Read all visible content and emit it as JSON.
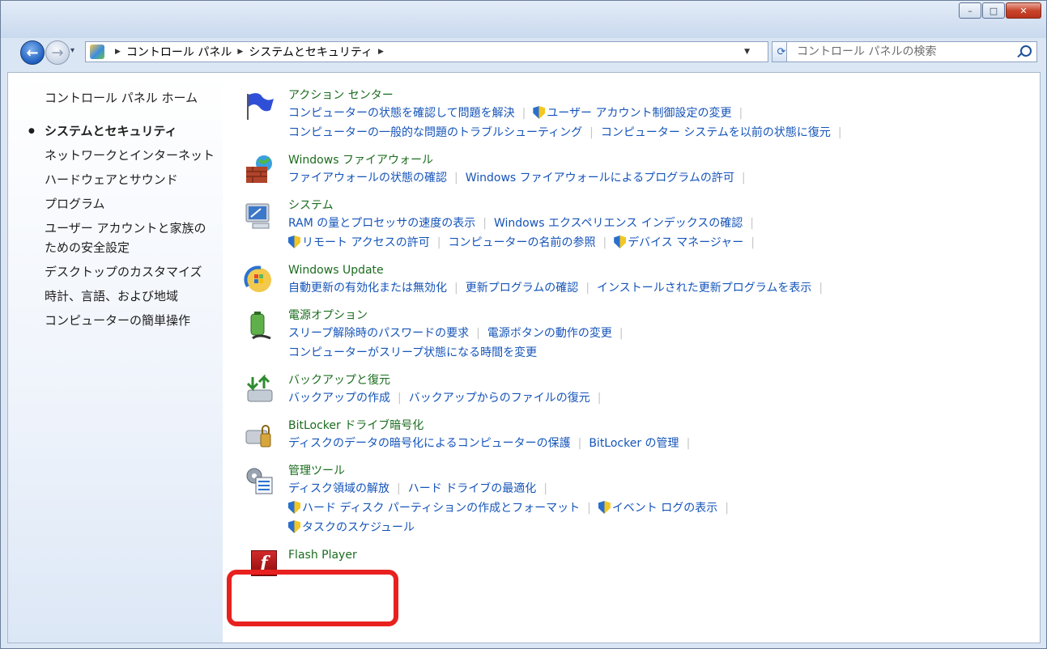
{
  "window": {
    "minimize_glyph": "–",
    "maximize_glyph": "□",
    "close_glyph": "✕"
  },
  "nav": {
    "back_glyph": "←",
    "forward_glyph": "→",
    "dropdown_glyph": "▾",
    "breadcrumb": [
      "コントロール パネル",
      "システムとセキュリティ"
    ],
    "crumb_sep": "▶",
    "address_dropdown_glyph": "▼",
    "refresh_glyph": "⟳",
    "search_placeholder": "コントロール パネルの検索"
  },
  "sidebar": {
    "home": "コントロール パネル ホーム",
    "items": [
      {
        "label": "システムとセキュリティ",
        "active": true
      },
      {
        "label": "ネットワークとインターネット"
      },
      {
        "label": "ハードウェアとサウンド"
      },
      {
        "label": "プログラム"
      },
      {
        "label": "ユーザー アカウントと家族のための安全設定"
      },
      {
        "label": "デスクトップのカスタマイズ"
      },
      {
        "label": "時計、言語、および地域"
      },
      {
        "label": "コンピューターの簡単操作"
      }
    ]
  },
  "categories": [
    {
      "title": "アクション センター",
      "icon": "flag-icon",
      "links": [
        [
          {
            "text": "コンピューターの状態を確認して問題を解決"
          },
          {
            "text": "ユーザー アカウント制御設定の変更",
            "shield": true
          }
        ],
        [
          {
            "text": "コンピューターの一般的な問題のトラブルシューティング"
          },
          {
            "text": "コンピューター システムを以前の状態に復元"
          }
        ]
      ]
    },
    {
      "title": "Windows ファイアウォール",
      "icon": "firewall-icon",
      "links": [
        [
          {
            "text": "ファイアウォールの状態の確認"
          },
          {
            "text": "Windows ファイアウォールによるプログラムの許可"
          }
        ]
      ]
    },
    {
      "title": "システム",
      "icon": "system-icon",
      "links": [
        [
          {
            "text": "RAM の量とプロセッサの速度の表示"
          },
          {
            "text": "Windows エクスペリエンス インデックスの確認"
          }
        ],
        [
          {
            "text": "リモート アクセスの許可",
            "shield": true
          },
          {
            "text": "コンピューターの名前の参照"
          },
          {
            "text": "デバイス マネージャー",
            "shield": true
          }
        ]
      ]
    },
    {
      "title": "Windows Update",
      "icon": "windows-update-icon",
      "links": [
        [
          {
            "text": "自動更新の有効化または無効化"
          },
          {
            "text": "更新プログラムの確認"
          },
          {
            "text": "インストールされた更新プログラムを表示"
          }
        ]
      ]
    },
    {
      "title": "電源オプション",
      "icon": "battery-icon",
      "links": [
        [
          {
            "text": "スリープ解除時のパスワードの要求"
          },
          {
            "text": "電源ボタンの動作の変更"
          }
        ],
        [
          {
            "text": "コンピューターがスリープ状態になる時間を変更"
          }
        ]
      ]
    },
    {
      "title": "バックアップと復元",
      "icon": "backup-icon",
      "links": [
        [
          {
            "text": "バックアップの作成"
          },
          {
            "text": "バックアップからのファイルの復元"
          }
        ]
      ]
    },
    {
      "title": "BitLocker ドライブ暗号化",
      "icon": "bitlocker-icon",
      "links": [
        [
          {
            "text": "ディスクのデータの暗号化によるコンピューターの保護"
          },
          {
            "text": "BitLocker の管理"
          }
        ]
      ]
    },
    {
      "title": "管理ツール",
      "icon": "admin-tools-icon",
      "links": [
        [
          {
            "text": "ディスク領域の解放"
          },
          {
            "text": "ハード ドライブの最適化"
          }
        ],
        [
          {
            "text": "ハード ディスク パーティションの作成とフォーマット",
            "shield": true
          },
          {
            "text": "イベント ログの表示",
            "shield": true
          }
        ],
        [
          {
            "text": "タスクのスケジュール",
            "shield": true
          }
        ]
      ]
    },
    {
      "title": "Flash Player",
      "icon": "flash-player-icon",
      "icon_letter": "f",
      "links": []
    }
  ],
  "colors": {
    "highlight": "#e8211f",
    "category_title": "#1b6c1e",
    "link": "#1554b9"
  }
}
